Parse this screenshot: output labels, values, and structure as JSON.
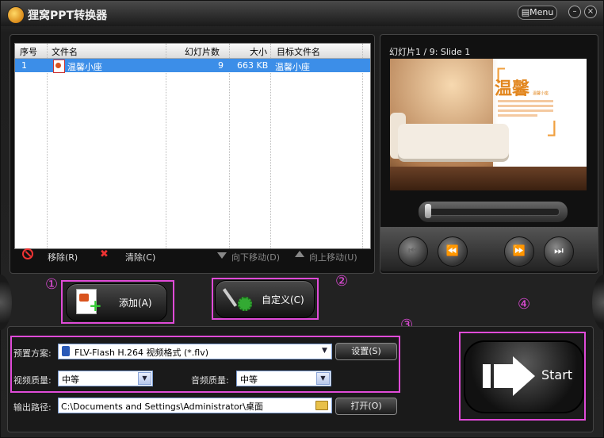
{
  "app": {
    "title": "狸窝PPT转换器",
    "menu_label": "Menu",
    "minimize_glyph": "–",
    "close_glyph": "×"
  },
  "table": {
    "columns": [
      "序号",
      "文件名",
      "幻灯片数",
      "大小",
      "目标文件名"
    ],
    "rows": [
      {
        "index": "1",
        "filename": "温馨小座",
        "slides": "9",
        "size": "663 KB",
        "target": "温馨小座"
      }
    ]
  },
  "toolbar": {
    "remove": "移除(R)",
    "clear": "清除(C)",
    "move_down": "向下移动(D)",
    "move_up": "向上移动(U)"
  },
  "preview": {
    "label": "幻灯片1 / 9: Slide 1",
    "slide_title": "温馨",
    "slide_sub": "温馨小座",
    "progress": 0.0
  },
  "buttons": {
    "add": "添加(A)",
    "custom": "自定义(C)",
    "start": "Start"
  },
  "markers": {
    "m1": "①",
    "m2": "②",
    "m3": "③",
    "m4": "④"
  },
  "settings": {
    "preset_label": "预置方案:",
    "preset_value": "FLV-Flash H.264 视频格式 (*.flv)",
    "settings_button": "设置(S)",
    "video_quality_label": "视频质量:",
    "video_quality_value": "中等",
    "audio_quality_label": "音频质量:",
    "audio_quality_value": "中等",
    "output_label": "输出路径:",
    "output_value": "C:\\Documents and Settings\\Administrator\\桌面",
    "open_button": "打开(O)"
  },
  "colors": {
    "highlight": "#e04bd8",
    "selection": "#3c8ee8",
    "accent_orange": "#e2871f"
  }
}
